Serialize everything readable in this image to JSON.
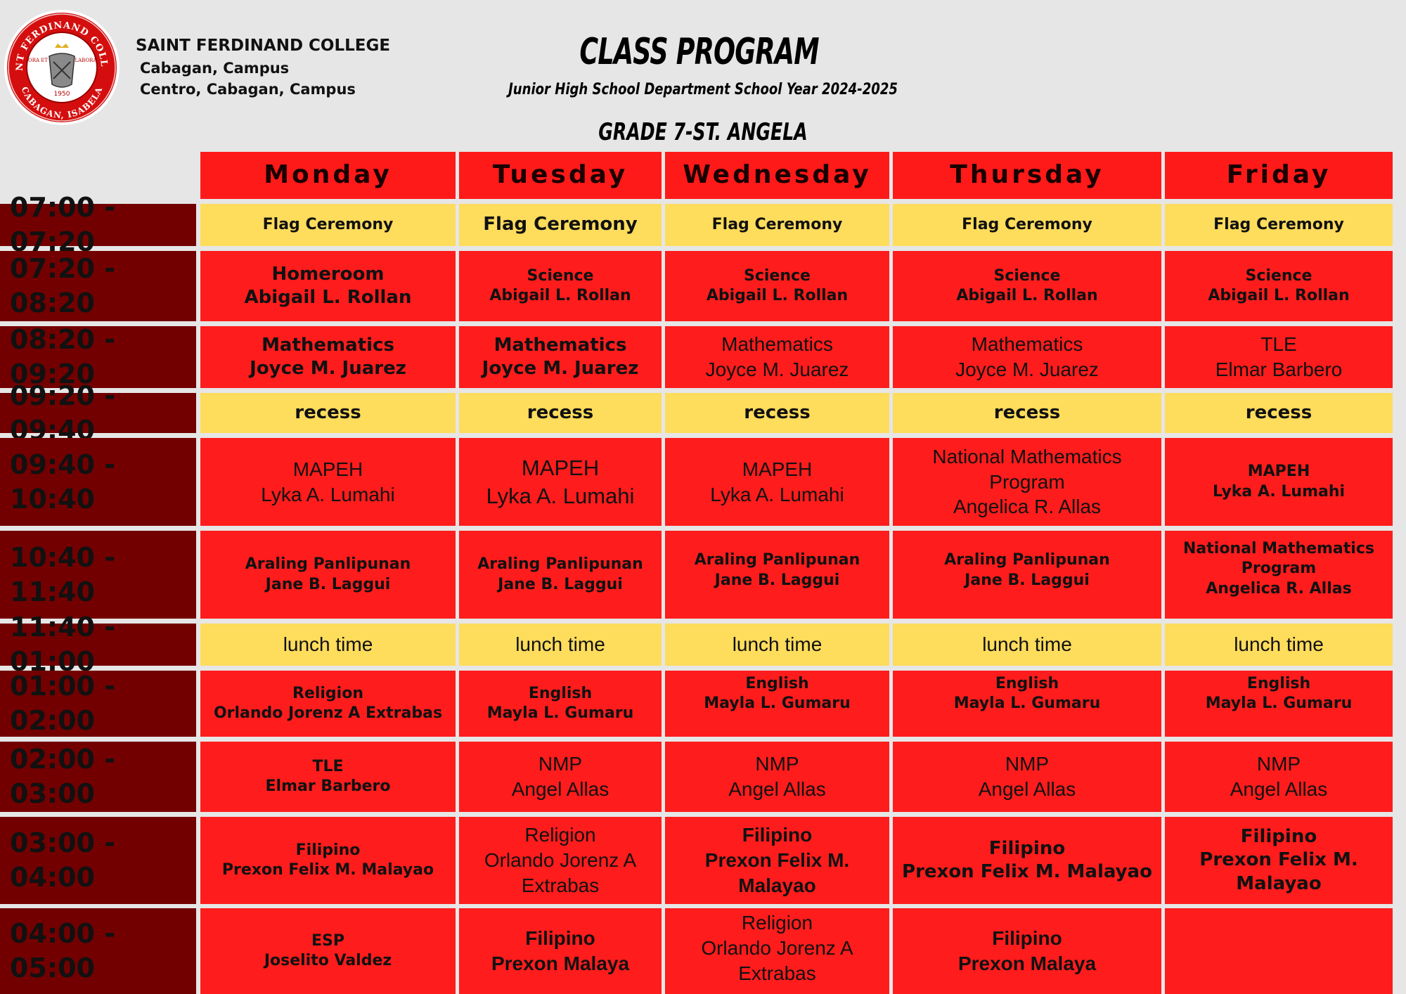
{
  "header": {
    "seal": {
      "ring_text_top": "SAINT FERDINAND COLLEGE",
      "ring_text_bottom": "CABAGAN, ISABELA",
      "motto_left": "ORA ET",
      "motto_right": "LABORA",
      "year": "1950",
      "colors": {
        "ring": "#d40e0e",
        "inner": "#ffffff"
      }
    },
    "college_name": "SAINT FERDINAND COLLEGE",
    "campus_line1": "Cabagan, Campus",
    "campus_line2": "Centro, Cabagan, Campus",
    "title": "CLASS PROGRAM",
    "subtitle": "Junior High School Department School Year 2024-2025",
    "grade": "GRADE 7-ST. ANGELA"
  },
  "colors": {
    "background": "#e6e6e6",
    "time_cell": "#730000",
    "class_cell": "#fe1c1c",
    "break_cell": "#fedc5c"
  },
  "days": [
    "Monday",
    "Tuesday",
    "Wednesday",
    "Thursday",
    "Friday"
  ],
  "rows": [
    {
      "time": "07:00 - 07:20",
      "cells": [
        [
          "Flag Ceremony"
        ],
        [
          "Flag Ceremony"
        ],
        [
          "Flag Ceremony"
        ],
        [
          "Flag Ceremony"
        ],
        [
          "Flag Ceremony"
        ]
      ]
    },
    {
      "time": "07:20 - 08:20",
      "cells": [
        [
          "Homeroom",
          "Abigail L. Rollan"
        ],
        [
          "Science",
          "Abigail L. Rollan"
        ],
        [
          "Science",
          "Abigail L. Rollan"
        ],
        [
          "Science",
          "Abigail L. Rollan"
        ],
        [
          "Science",
          "Abigail L. Rollan"
        ]
      ]
    },
    {
      "time": "08:20 - 09:20",
      "cells": [
        [
          "Mathematics",
          "Joyce M. Juarez"
        ],
        [
          "Mathematics",
          "Joyce M. Juarez"
        ],
        [
          "Mathematics",
          "Joyce M. Juarez"
        ],
        [
          "Mathematics",
          "Joyce M. Juarez"
        ],
        [
          "TLE",
          "Elmar Barbero"
        ]
      ]
    },
    {
      "time": "09:20 - 09:40",
      "cells": [
        [
          "recess"
        ],
        [
          "recess"
        ],
        [
          "recess"
        ],
        [
          "recess"
        ],
        [
          "recess"
        ]
      ]
    },
    {
      "time": "09:40 - 10:40",
      "cells": [
        [
          "MAPEH",
          "Lyka A. Lumahi"
        ],
        [
          "MAPEH",
          "Lyka A. Lumahi"
        ],
        [
          "MAPEH",
          "Lyka A. Lumahi"
        ],
        [
          "National Mathematics",
          "Program",
          "Angelica R. Allas"
        ],
        [
          "MAPEH",
          "Lyka A. Lumahi"
        ]
      ]
    },
    {
      "time": "10:40 - 11:40",
      "cells": [
        [
          "Araling Panlipunan",
          "Jane B. Laggui"
        ],
        [
          "Araling Panlipunan",
          "Jane B. Laggui"
        ],
        [
          "Araling Panlipunan",
          "Jane B. Laggui"
        ],
        [
          "Araling Panlipunan",
          "Jane B. Laggui"
        ],
        [
          "National Mathematics",
          "Program",
          "Angelica R. Allas"
        ]
      ]
    },
    {
      "time": "11:40 - 01:00",
      "cells": [
        [
          "lunch time"
        ],
        [
          "lunch time"
        ],
        [
          "lunch time"
        ],
        [
          "lunch time"
        ],
        [
          "lunch time"
        ]
      ]
    },
    {
      "time": "01:00 - 02:00",
      "cells": [
        [
          "Religion",
          "Orlando Jorenz A Extrabas"
        ],
        [
          "English",
          "Mayla L. Gumaru"
        ],
        [
          "English",
          "Mayla L. Gumaru"
        ],
        [
          "English",
          "Mayla L. Gumaru"
        ],
        [
          "English",
          "Mayla L. Gumaru"
        ]
      ]
    },
    {
      "time": "02:00 - 03:00",
      "cells": [
        [
          "TLE",
          "Elmar Barbero"
        ],
        [
          "NMP",
          "Angel Allas"
        ],
        [
          "NMP",
          "Angel Allas"
        ],
        [
          "NMP",
          "Angel Allas"
        ],
        [
          "NMP",
          "Angel Allas"
        ]
      ]
    },
    {
      "time": "03:00 - 04:00",
      "cells": [
        [
          "Filipino",
          "Prexon Felix M. Malayao"
        ],
        [
          "Religion",
          "Orlando Jorenz A",
          "Extrabas"
        ],
        [
          "Filipino",
          "Prexon Felix M.",
          "Malayao"
        ],
        [
          "Filipino",
          "Prexon Felix M. Malayao"
        ],
        [
          "Filipino",
          "Prexon Felix M. Malayao"
        ]
      ]
    },
    {
      "time": "04:00 - 05:00",
      "cells": [
        [
          "ESP",
          "Joselito Valdez"
        ],
        [
          "Filipino",
          "Prexon Malaya"
        ],
        [
          "Religion",
          "Orlando Jorenz A",
          "Extrabas"
        ],
        [
          "Filipino",
          "Prexon Malaya"
        ],
        []
      ]
    }
  ]
}
